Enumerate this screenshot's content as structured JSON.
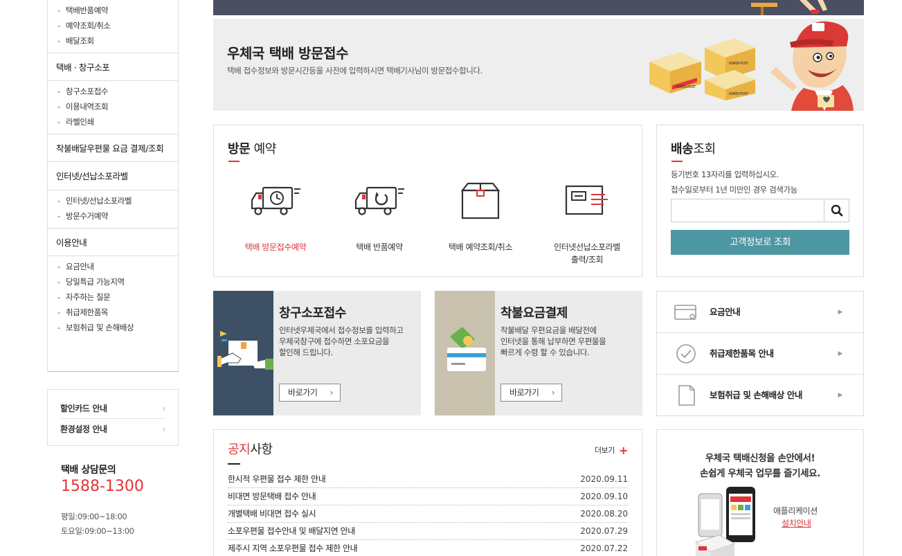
{
  "sidebar": {
    "group1_items": [
      "택배반품예약",
      "예약조회/취소",
      "배달조회"
    ],
    "cat_counter": "택배 · 창구소포",
    "group2_items": [
      "창구소포접수",
      "이용내역조회",
      "라벨인쇄"
    ],
    "cat_cod": "착불배달우편물 요금 결제/조회",
    "cat_internet": "인터넷/선납소포라벨",
    "group3_items": [
      "인터넷/선납소포라벨",
      "방문수거예약"
    ],
    "cat_guide": "이용안내",
    "group4_items": [
      "요금안내",
      "당일특급 가능지역",
      "자주하는 질문",
      "취급제한품목",
      "보험취급 및 손해배상"
    ],
    "links": [
      {
        "label": "할인카드 안내",
        "chev": "›"
      },
      {
        "label": "환경설정 안내",
        "chev": "›"
      }
    ],
    "cs": {
      "title": "택배 상담문의",
      "phone": "1588-1300",
      "weekday": "평일:09:00~18:00",
      "saturday": "토요일:09:00~13:00"
    }
  },
  "banner": {
    "title": "우체국 택배 방문접수",
    "desc": "택배 접수정보와 방문시간등을 사전에 입력하시면 택배기사님이 방문접수합니다.",
    "box_text": "KOREA POST"
  },
  "visit": {
    "title_bold": "방문",
    "title_rest": " 예약",
    "items": [
      {
        "label": "택배 방문접수예약"
      },
      {
        "label": "택배 반품예약"
      },
      {
        "label": "택배 예약조회/취소"
      },
      {
        "label_line1": "인터넷선납소포라벨",
        "label_line2": "출력/조회"
      }
    ]
  },
  "track": {
    "title_bold": "배송",
    "title_rest": "조회",
    "guide1": "등기번호 13자리를 입력하십시오.",
    "guide2": "접수일로부터 1년 미만인 경우 검색가능",
    "input_value": "",
    "button": "고객정보로 조회"
  },
  "promos": [
    {
      "title": "창구소포접수",
      "desc": [
        "인터넷우체국에서 접수정보를 입력하고",
        "우체국창구에 접수하면 소포요금을",
        "할인해 드립니다."
      ],
      "button": "바로가기",
      "arrow": "›"
    },
    {
      "title": "착불요금결제",
      "desc": [
        "착불배달 우편요금을 배달전에",
        "인터넷을 통해 납부하면 우편물을",
        "빠르게 수령 할 수 있습니다."
      ],
      "button": "바로가기",
      "arrow": "›"
    }
  ],
  "right_links": [
    {
      "label": "요금안내",
      "icon": "card-icon",
      "arrow": "▶"
    },
    {
      "label": "취급제한품목 안내",
      "icon": "check-circle-icon",
      "arrow": "▶"
    },
    {
      "label": "보험취급 및 손해배상 안내",
      "icon": "document-icon",
      "arrow": "▶"
    }
  ],
  "notice": {
    "title_red": "공지",
    "title_rest": "사항",
    "more": "더보기",
    "plus": "+",
    "rows": [
      {
        "title": "한시적 우편물 접수 제한 안내",
        "date": "2020.09.11"
      },
      {
        "title": "비대면 방문택배 접수 안내",
        "date": "2020.09.10"
      },
      {
        "title": "개별택배 비대면 접수 실시",
        "date": "2020.08.20"
      },
      {
        "title": "소포우편물 접수안내 및 배달지연 안내",
        "date": "2020.07.29"
      },
      {
        "title": "제주시 지역 소포우편물 접수 제한 안내",
        "date": "2020.07.22"
      }
    ]
  },
  "app": {
    "line1": "우체국 택배신청을 손안에서!",
    "line2": "손쉽게 우체국 업무를 즐기세요.",
    "label": "애플리케이션",
    "link": "설치안내"
  },
  "colors": {
    "accent": "#e0343a",
    "teal": "#4d97a3",
    "navy": "#3d5066",
    "khaki": "#c8c2ae"
  }
}
